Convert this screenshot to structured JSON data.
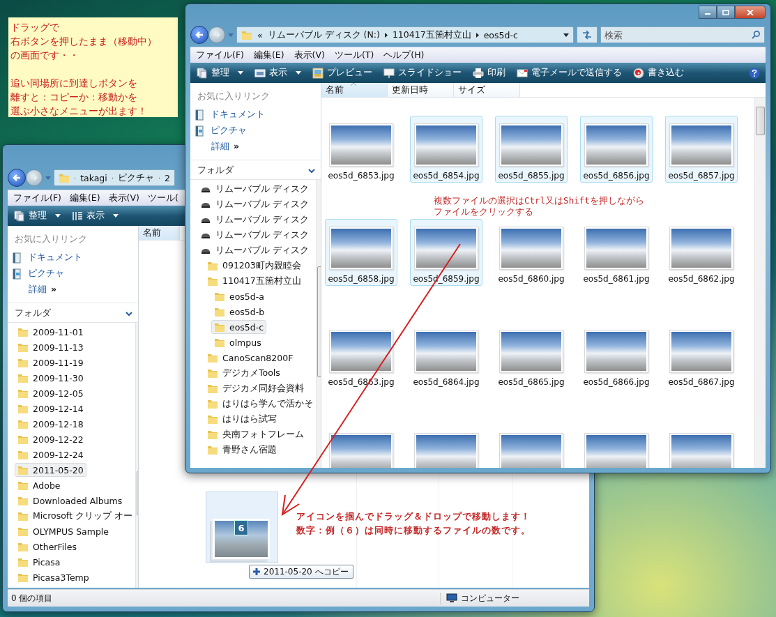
{
  "note": {
    "paragraphs": [
      [
        "ドラッグで",
        "右ボタンを押したまま（移動中）",
        "の画面です・・"
      ],
      [
        "追い同場所に到達しボタンを",
        "離すと：コピーか：移動かを",
        "選ぶ小さなメニューが出ます！"
      ]
    ]
  },
  "back_window": {
    "address": {
      "crumbs": [
        "takagi",
        "ピクチャ",
        "2"
      ]
    },
    "menu": [
      "ファイル(F)",
      "編集(E)",
      "表示(V)",
      "ツール("
    ],
    "toolbar": [
      {
        "label": "整理",
        "kind": "pages",
        "dropdown": true
      },
      {
        "label": "表示",
        "kind": "list",
        "dropdown": true
      }
    ],
    "favorites": {
      "title": "お気に入りリンク",
      "items": [
        {
          "label": "ドキュメント",
          "kind": "document"
        },
        {
          "label": "ピクチャ",
          "kind": "picture"
        }
      ],
      "more": "詳細",
      "more_marker": "»"
    },
    "folders": {
      "title": "フォルダ",
      "items": [
        {
          "label": "2009-11-01",
          "kind": "folder",
          "selected": false
        },
        {
          "label": "2009-11-13",
          "kind": "folder",
          "selected": false
        },
        {
          "label": "2009-11-19",
          "kind": "folder",
          "selected": false
        },
        {
          "label": "2009-11-30",
          "kind": "folder",
          "selected": false
        },
        {
          "label": "2009-12-05",
          "kind": "folder",
          "selected": false
        },
        {
          "label": "2009-12-14",
          "kind": "folder",
          "selected": false
        },
        {
          "label": "2009-12-18",
          "kind": "folder",
          "selected": false
        },
        {
          "label": "2009-12-22",
          "kind": "folder",
          "selected": false
        },
        {
          "label": "2009-12-24",
          "kind": "folder",
          "selected": false
        },
        {
          "label": "2011-05-20",
          "kind": "folder",
          "selected": true
        },
        {
          "label": "Adobe",
          "kind": "folder",
          "selected": false
        },
        {
          "label": "Downloaded Albums",
          "kind": "folder",
          "selected": false
        },
        {
          "label": "Microsoft クリップ オー",
          "kind": "folder",
          "selected": false
        },
        {
          "label": "OLYMPUS Sample",
          "kind": "folder",
          "selected": false
        },
        {
          "label": "OtherFiles",
          "kind": "folder",
          "selected": false
        },
        {
          "label": "Picasa",
          "kind": "folder",
          "selected": false
        },
        {
          "label": "Picasa3Temp",
          "kind": "folder",
          "selected": false
        }
      ]
    },
    "columns": [
      {
        "label": "名前",
        "sorted": false
      }
    ],
    "status_bar": {
      "items": "0 個の項目",
      "location": "コンピューター"
    }
  },
  "front_window": {
    "address": {
      "overflow": "«",
      "crumbs": [
        "リムーバブル ディスク (N:)",
        "110417五箇村立山",
        "eos5d-c"
      ]
    },
    "search": {
      "placeholder": "検索"
    },
    "menu": [
      "ファイル(F)",
      "編集(E)",
      "表示(V)",
      "ツール(T)",
      "ヘルプ(H)"
    ],
    "toolbar": [
      {
        "label": "整理",
        "kind": "pages",
        "dropdown": true
      },
      {
        "label": "表示",
        "kind": "window",
        "dropdown": true
      },
      {
        "label": "プレビュー",
        "kind": "picture",
        "dropdown": false
      },
      {
        "label": "スライドショー",
        "kind": "screen",
        "dropdown": false
      },
      {
        "label": "印刷",
        "kind": "printer",
        "dropdown": false
      },
      {
        "label": "電子メールで送信する",
        "kind": "envelope",
        "dropdown": false
      },
      {
        "label": "書き込む",
        "kind": "disc",
        "dropdown": false
      }
    ],
    "favorites": {
      "title": "お気に入りリンク",
      "items": [
        {
          "label": "ドキュメント",
          "kind": "document"
        },
        {
          "label": "ピクチャ",
          "kind": "picture"
        }
      ],
      "more": "詳細",
      "more_marker": "»"
    },
    "folders": {
      "title": "フォルダ",
      "items": [
        {
          "label": "リムーバブル ディスク",
          "kind": "drive",
          "selected": false
        },
        {
          "label": "リムーバブル ディスク",
          "kind": "drive",
          "selected": false
        },
        {
          "label": "リムーバブル ディスク",
          "kind": "drive",
          "selected": false
        },
        {
          "label": "リムーバブル ディスク",
          "kind": "drive",
          "selected": false
        },
        {
          "label": "リムーバブル ディスク",
          "kind": "drive",
          "selected": false,
          "children": [
            {
              "label": "091203町内親睦会",
              "kind": "folder",
              "selected": false
            },
            {
              "label": "110417五箇村立山",
              "kind": "folder",
              "selected": false,
              "children": [
                {
                  "label": "eos5d-a",
                  "kind": "folder",
                  "selected": false
                },
                {
                  "label": "eos5d-b",
                  "kind": "folder",
                  "selected": false
                },
                {
                  "label": "eos5d-c",
                  "kind": "folder",
                  "selected": true
                },
                {
                  "label": "olmpus",
                  "kind": "folder",
                  "selected": false
                }
              ]
            },
            {
              "label": "CanoScan8200F",
              "kind": "folder",
              "selected": false
            },
            {
              "label": "デジカメTools",
              "kind": "folder",
              "selected": false
            },
            {
              "label": "デジカメ同好会資料",
              "kind": "folder",
              "selected": false
            },
            {
              "label": "はりはら学んで活かそ",
              "kind": "folder",
              "selected": false
            },
            {
              "label": "はりはら試写",
              "kind": "folder",
              "selected": false
            },
            {
              "label": "央南フォトフレーム",
              "kind": "folder",
              "selected": false
            },
            {
              "label": "青野さん宿題",
              "kind": "folder",
              "selected": false
            }
          ]
        }
      ]
    },
    "columns": [
      {
        "label": "名前",
        "sorted": true
      },
      {
        "label": "更新日時",
        "sorted": false
      },
      {
        "label": "サイズ",
        "sorted": false
      }
    ],
    "files": [
      {
        "name": "eos5d_6853.jpg",
        "selected": false
      },
      {
        "name": "eos5d_6854.jpg",
        "selected": true
      },
      {
        "name": "eos5d_6855.jpg",
        "selected": true
      },
      {
        "name": "eos5d_6856.jpg",
        "selected": true
      },
      {
        "name": "eos5d_6857.jpg",
        "selected": true
      },
      {
        "name": "eos5d_6858.jpg",
        "selected": true
      },
      {
        "name": "eos5d_6859.jpg",
        "selected": true
      },
      {
        "name": "eos5d_6860.jpg",
        "selected": false
      },
      {
        "name": "eos5d_6861.jpg",
        "selected": false
      },
      {
        "name": "eos5d_6862.jpg",
        "selected": false
      },
      {
        "name": "eos5d_6863.jpg",
        "selected": false
      },
      {
        "name": "eos5d_6864.jpg",
        "selected": false
      },
      {
        "name": "eos5d_6865.jpg",
        "selected": false
      },
      {
        "name": "eos5d_6866.jpg",
        "selected": false
      },
      {
        "name": "eos5d_6867.jpg",
        "selected": false
      },
      {
        "selected": false
      },
      {
        "selected": false
      },
      {
        "selected": false
      },
      {
        "selected": false
      },
      {
        "selected": false
      }
    ]
  },
  "annotations": [
    [
      "複数ファイルの選択はCtrl又はShiftを押しながら",
      "ファイルをクリックする"
    ],
    [
      "アイコンを掴んでドラッグ＆ドロップで移動します！",
      "数字：例（６）は同時に移動するファイルの数です。"
    ]
  ],
  "drag": {
    "count": "6",
    "tooltip": "2011-05-20 へコピー"
  }
}
